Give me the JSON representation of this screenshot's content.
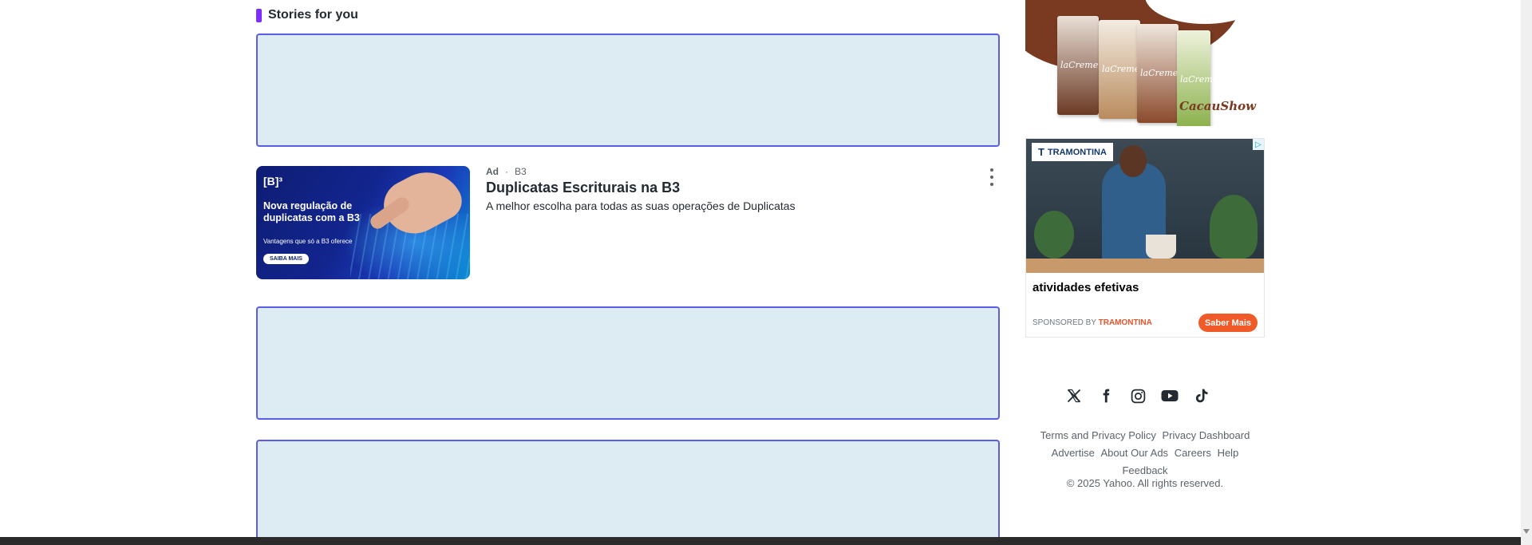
{
  "section": {
    "title": "Stories for you"
  },
  "ad": {
    "label": "Ad",
    "separator": "·",
    "source": "B3",
    "title": "Duplicatas Escriturais na B3",
    "description": "A melhor escolha para todas as suas operações de Duplicatas",
    "thumb": {
      "logo": "[B]³",
      "headline": "Nova regulação de duplicatas com a B3",
      "subtext": "Vantagens que só a B3 oferece",
      "button": "SAIBA MAIS"
    }
  },
  "right_ads": {
    "cacau": {
      "package_label": "laCreme",
      "brand": "CacauShow"
    },
    "tramontina": {
      "logo": "TRAMONTINA",
      "headline": "atividades efetivas",
      "sponsored_prefix": "SPONSORED BY",
      "sponsor": "TRAMONTINA",
      "cta": "Saber Mais",
      "adchoice": "▷"
    }
  },
  "footer": {
    "links_row1": [
      "Terms and Privacy Policy",
      "Privacy Dashboard"
    ],
    "links_row2": [
      "Advertise",
      "About Our Ads",
      "Careers",
      "Help"
    ],
    "links_row3": [
      "Feedback"
    ],
    "copyright": "© 2025 Yahoo. All rights reserved."
  },
  "social_icons": [
    "x-icon",
    "facebook-icon",
    "instagram-icon",
    "youtube-icon",
    "tiktok-icon"
  ],
  "colors": {
    "accent": "#7d2eff",
    "placeholder_bg": "#ddebf3",
    "placeholder_border": "#5b5de6",
    "cta": "#f05a28"
  }
}
